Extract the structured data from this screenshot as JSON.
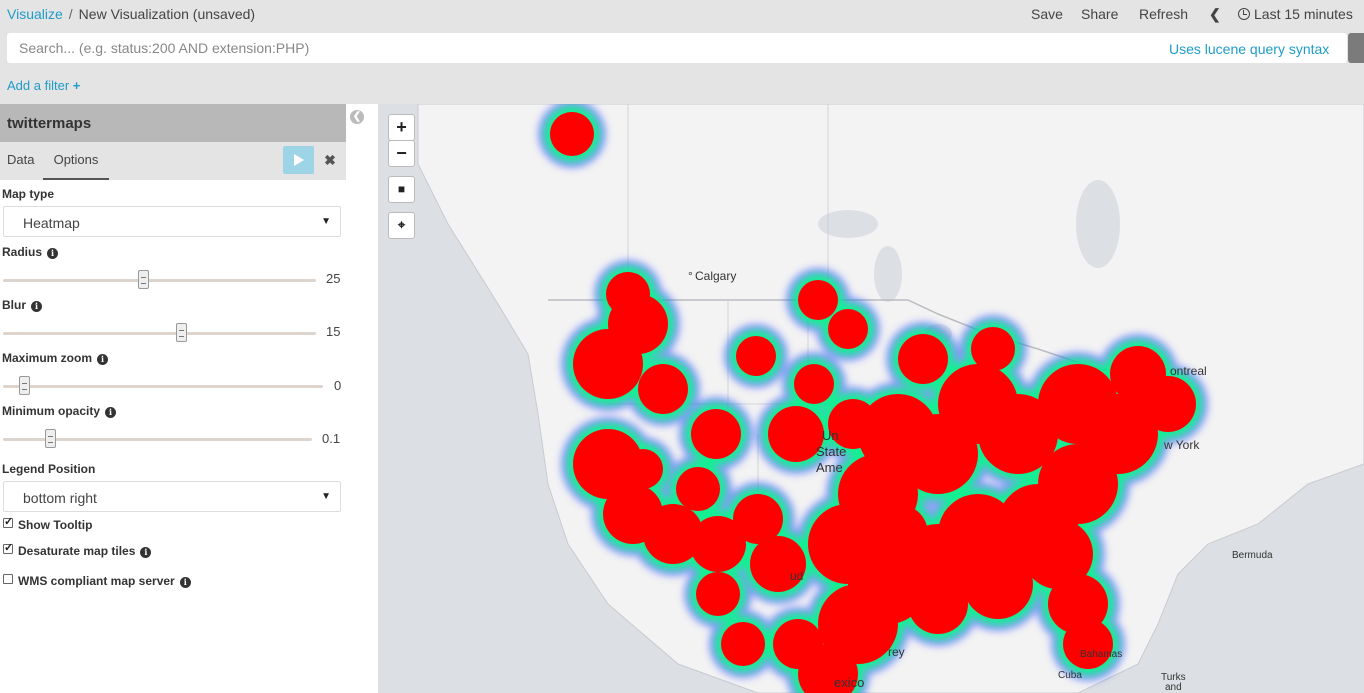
{
  "breadcrumb": {
    "root": "Visualize",
    "separator": "/",
    "current": "New Visualization (unsaved)"
  },
  "topnav": {
    "save": "Save",
    "share": "Share",
    "refresh": "Refresh",
    "time": "Last 15 minutes"
  },
  "search": {
    "placeholder": "Search... (e.g. status:200 AND extension:PHP)",
    "hint": "Uses lucene query syntax"
  },
  "filter": {
    "add_label": "Add a filter",
    "add_icon": "+"
  },
  "sidebar": {
    "title": "twittermaps",
    "tabs": [
      "Data",
      "Options"
    ],
    "discard_icon": "✖",
    "map_type_label": "Map type",
    "map_type_value": "Heatmap",
    "radius_label": "Radius",
    "radius_value": "25",
    "blur_label": "Blur",
    "blur_value": "15",
    "maxzoom_label": "Maximum zoom",
    "maxzoom_value": "0",
    "minopacity_label": "Minimum opacity",
    "minopacity_value": "0.1",
    "legend_label": "Legend Position",
    "legend_value": "bottom right",
    "show_tooltip": "Show Tooltip",
    "desaturate": "Desaturate map tiles",
    "wms": "WMS compliant map server",
    "info_icon": "i"
  },
  "map": {
    "zoom_in": "+",
    "zoom_out": "−",
    "labels": {
      "calgary": "Calgary",
      "montreal": "ontreal",
      "newyork": "w York",
      "us1": "Un",
      "us2": "State",
      "us3": "Ame",
      "bermuda": "Bermuda",
      "bahamas": "Bahamas",
      "cuba": "Cuba",
      "turks1": "Turks",
      "turks2": "and",
      "mexico": "exico",
      "monterrey": "rey",
      "juarez": "ud"
    },
    "heat_colors": {
      "core": "#ff0000",
      "ring1": "#00ff80",
      "ring2": "#3050ff"
    }
  }
}
